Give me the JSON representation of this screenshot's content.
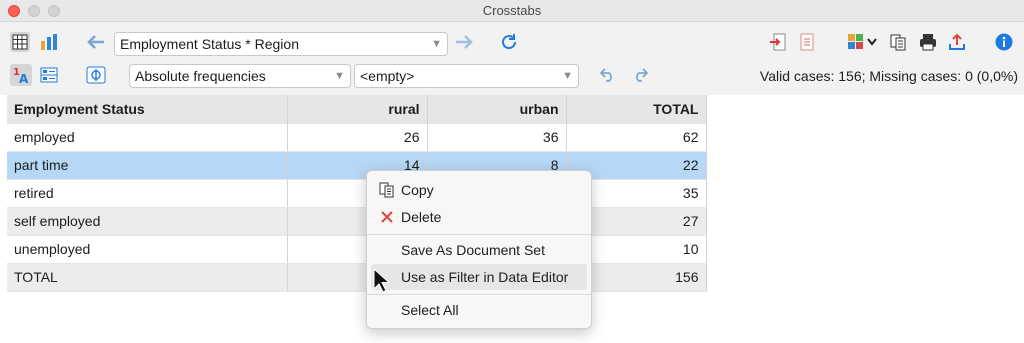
{
  "window": {
    "title": "Crosstabs"
  },
  "toolbar": {
    "table_selector": {
      "value": "Employment Status * Region"
    },
    "display_selector": {
      "value": "Absolute frequencies"
    },
    "filter_selector": {
      "value": "<empty>"
    },
    "status_text": "Valid cases: 156;  Missing cases: 0 (0,0%)"
  },
  "table": {
    "headers": [
      "Employment Status",
      "rural",
      "urban",
      "TOTAL"
    ],
    "rows": [
      {
        "label": "employed",
        "rural": "26",
        "urban": "36",
        "total": "62"
      },
      {
        "label": "part time",
        "rural": "14",
        "urban": "8",
        "total": "22"
      },
      {
        "label": "retired",
        "rural": "",
        "urban": "",
        "total": "35"
      },
      {
        "label": "self employed",
        "rural": "",
        "urban": "",
        "total": "27"
      },
      {
        "label": "unemployed",
        "rural": "",
        "urban": "",
        "total": "10"
      },
      {
        "label": "TOTAL",
        "rural": "",
        "urban": "",
        "total": "156"
      }
    ]
  },
  "context_menu": {
    "items": [
      {
        "label": "Copy",
        "icon": "copy-icon"
      },
      {
        "label": "Delete",
        "icon": "delete-x-icon"
      },
      {
        "label": "Save As Document Set"
      },
      {
        "label": "Use as Filter in Data Editor"
      },
      {
        "label": "Select All"
      }
    ]
  },
  "colors": {
    "selection": "#b6d7f6",
    "accent_blue": "#1d7be0",
    "delete_red": "#e0443e"
  }
}
